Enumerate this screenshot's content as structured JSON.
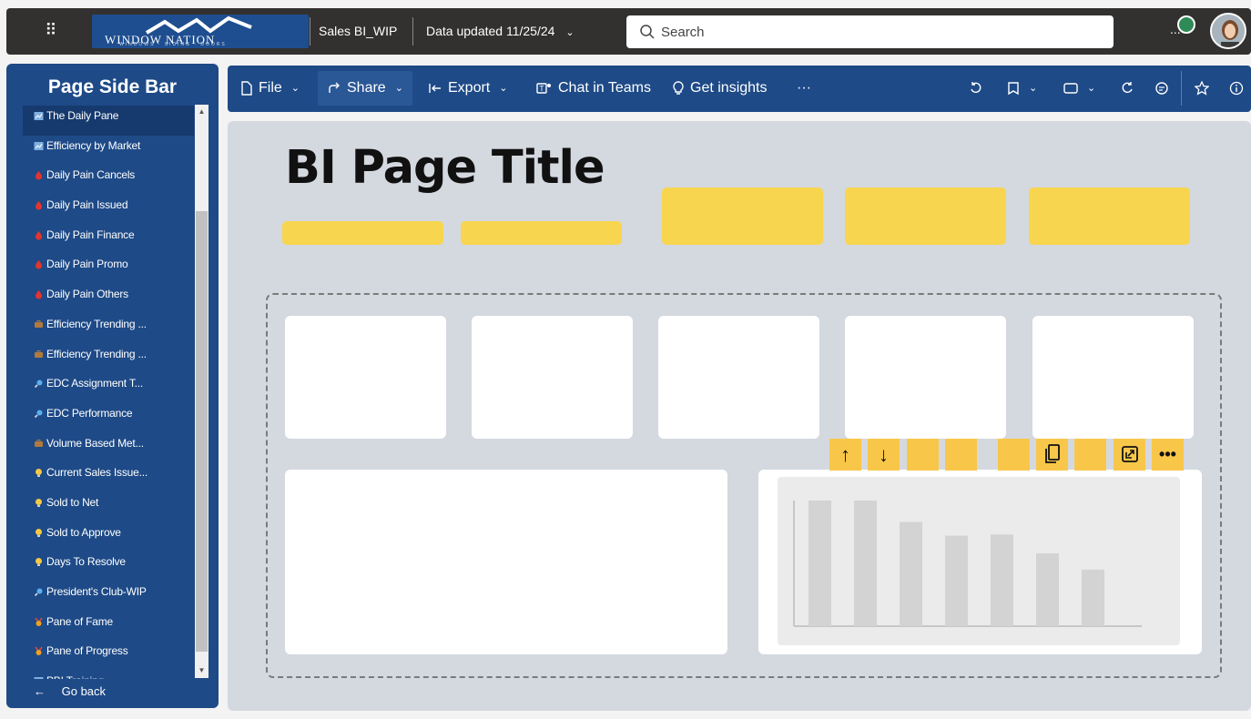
{
  "topbar": {
    "logo_text": "WINDOW NATION",
    "logo_sub": "WINDOWS · SIDING · DOORS",
    "report_name": "Sales BI_WIP",
    "data_updated": "Data updated 11/25/24",
    "search_placeholder": "Search",
    "overflow": "..."
  },
  "sidebar": {
    "title": "Page Side Bar",
    "items": [
      {
        "label": "The Daily Pane",
        "icon": "chart-icon",
        "color": "#7fb0e0"
      },
      {
        "label": "Efficiency by Market",
        "icon": "chart-icon",
        "color": "#7fb0e0"
      },
      {
        "label": "Daily Pain Cancels",
        "icon": "drop-icon",
        "color": "#e3342f"
      },
      {
        "label": "Daily Pain Issued",
        "icon": "drop-icon",
        "color": "#e3342f"
      },
      {
        "label": "Daily Pain Finance",
        "icon": "drop-icon",
        "color": "#e3342f"
      },
      {
        "label": "Daily Pain Promo",
        "icon": "drop-icon",
        "color": "#e3342f"
      },
      {
        "label": "Daily Pain Others",
        "icon": "drop-icon",
        "color": "#e3342f"
      },
      {
        "label": "Efficiency Trending ...",
        "icon": "briefcase-icon",
        "color": "#b07a3c"
      },
      {
        "label": "Efficiency Trending ...",
        "icon": "briefcase-icon",
        "color": "#b07a3c"
      },
      {
        "label": "EDC Assignment T...",
        "icon": "magnifier-icon",
        "color": "#5ab0f0"
      },
      {
        "label": "EDC Performance",
        "icon": "magnifier-icon",
        "color": "#5ab0f0"
      },
      {
        "label": "Volume Based Met...",
        "icon": "briefcase-icon",
        "color": "#b07a3c"
      },
      {
        "label": "Current Sales Issue...",
        "icon": "bulb-icon",
        "color": "#f6c945"
      },
      {
        "label": "Sold to Net",
        "icon": "bulb-icon",
        "color": "#f6c945"
      },
      {
        "label": "Sold to Approve",
        "icon": "bulb-icon",
        "color": "#f6c945"
      },
      {
        "label": "Days To Resolve",
        "icon": "bulb-icon",
        "color": "#f6c945"
      },
      {
        "label": "President's Club-WIP",
        "icon": "magnifier-icon",
        "color": "#5ab0f0"
      },
      {
        "label": "Pane of Fame",
        "icon": "medal-icon",
        "color": "#f0a020"
      },
      {
        "label": "Pane of Progress",
        "icon": "medal-icon",
        "color": "#f0a020"
      },
      {
        "label": "PBI Training",
        "icon": "chart-icon",
        "color": "#7fb0e0"
      }
    ],
    "go_back": "Go back"
  },
  "ribbon": {
    "file": "File",
    "share": "Share",
    "export": "Export",
    "chat": "Chat in Teams",
    "insights": "Get insights",
    "more": "···"
  },
  "canvas": {
    "page_title": "BI Page Title"
  },
  "chart_data": {
    "type": "bar",
    "categories": [
      "",
      "",
      "",
      "",
      "",
      "",
      ""
    ],
    "values": [
      100,
      100,
      83,
      72,
      73,
      58,
      45
    ],
    "ylim": [
      0,
      100
    ]
  },
  "colors": {
    "topbar": "#323130",
    "brand_blue": "#1e4a87",
    "canvas": "#d4d8df",
    "placeholder_yellow": "#f8d54e",
    "toolbar_yellow": "#f8c74a",
    "bar_gray": "#d3d3d3"
  }
}
